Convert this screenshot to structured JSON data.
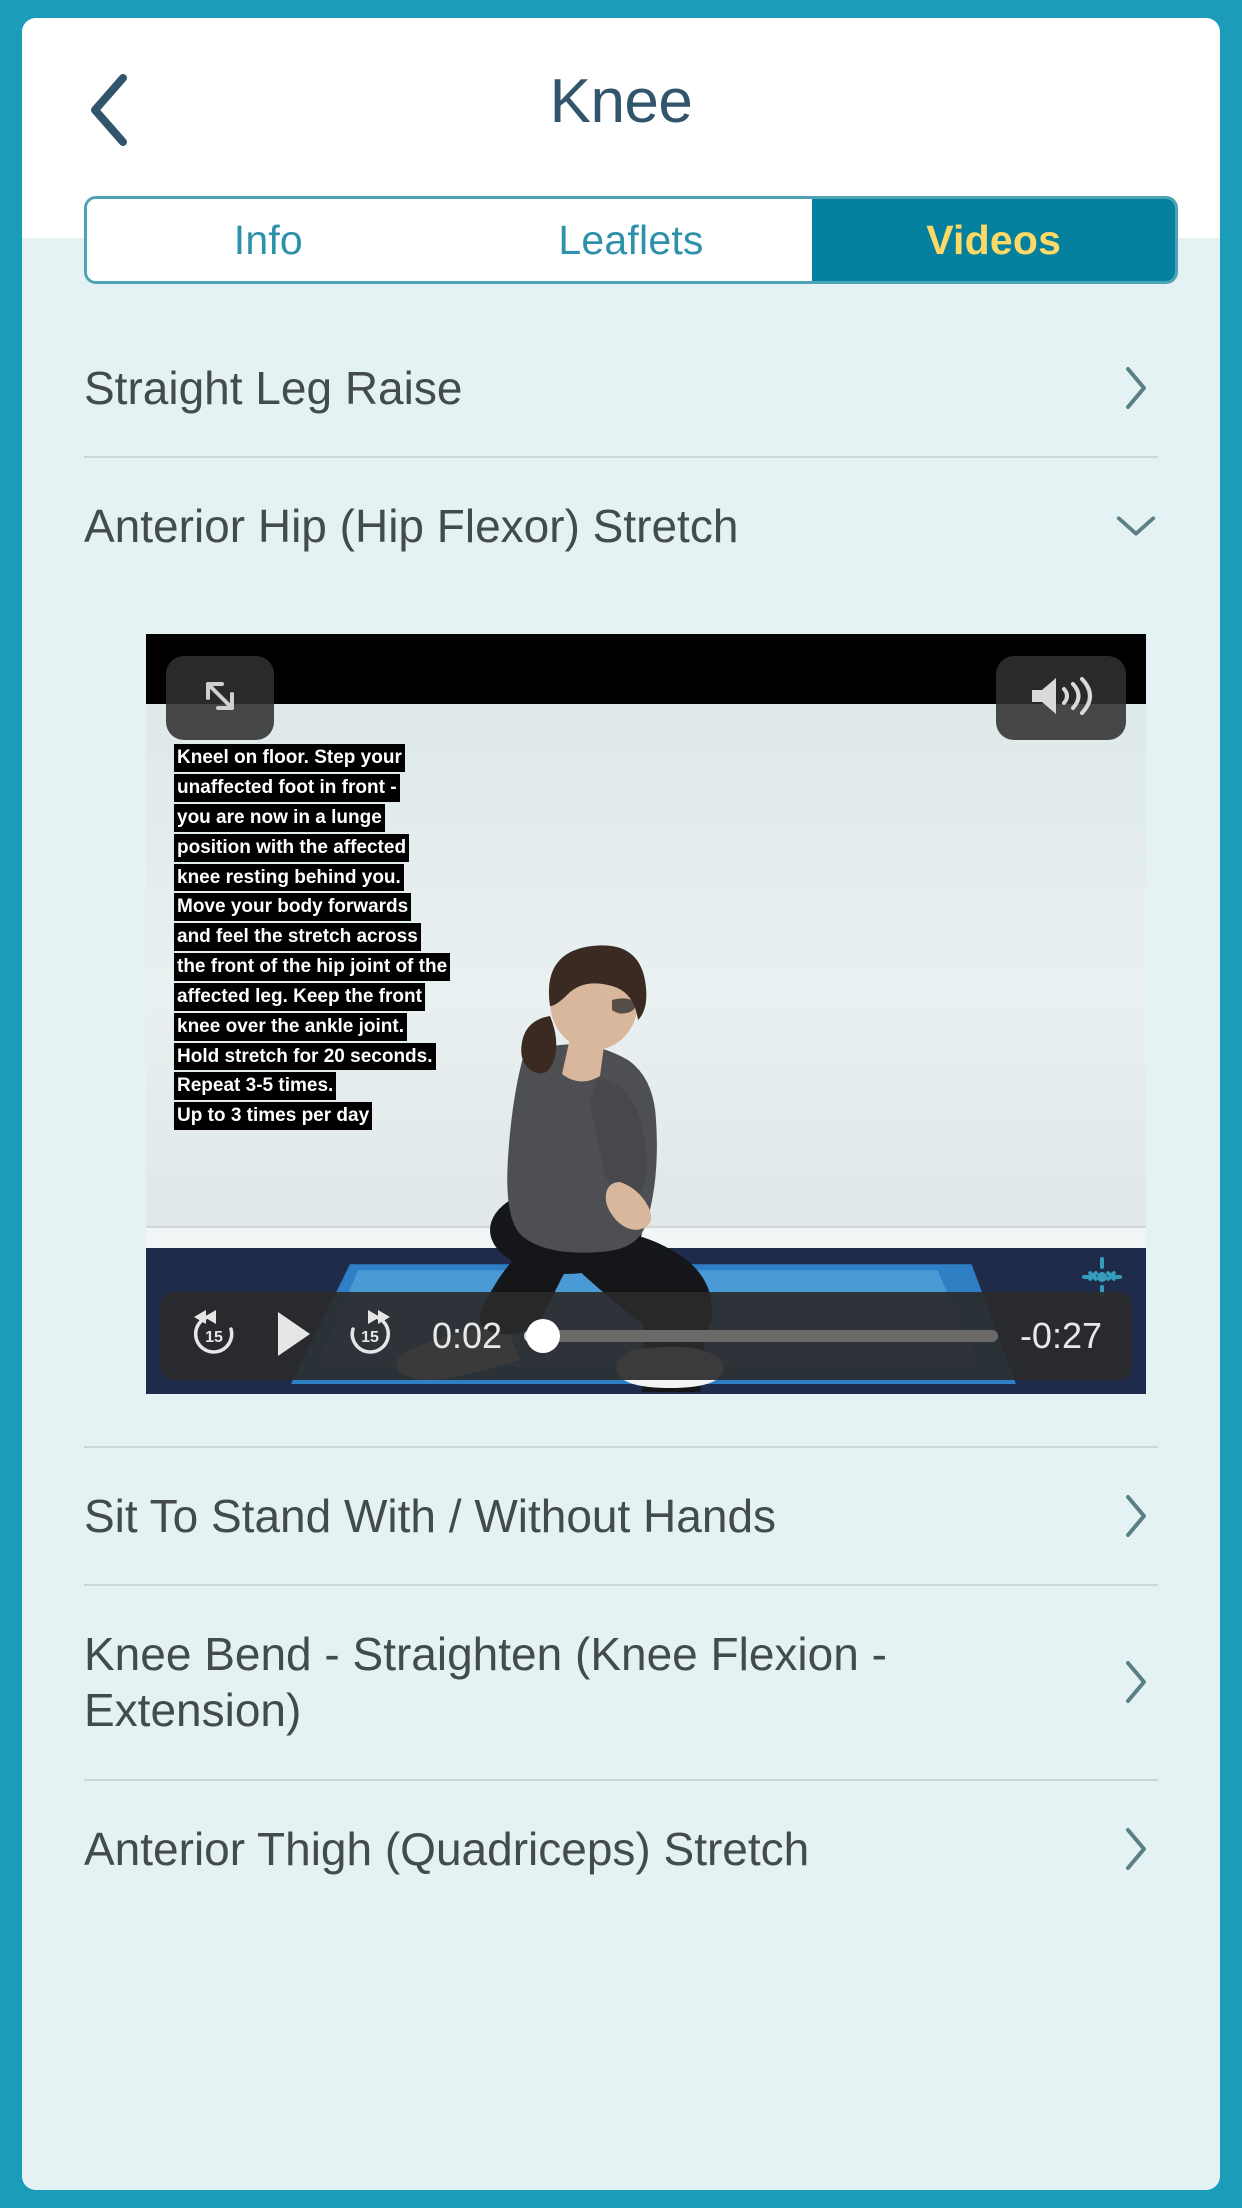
{
  "header": {
    "title": "Knee",
    "back_icon": "chevron-left-icon"
  },
  "tabs": [
    {
      "label": "Info",
      "active": false
    },
    {
      "label": "Leaflets",
      "active": false
    },
    {
      "label": "Videos",
      "active": true
    }
  ],
  "colors": {
    "app_frame": "#1b9cb8",
    "content_bg": "#e4f2f4",
    "tab_active_bg": "#05809e",
    "tab_active_text": "#ffd966",
    "tab_text": "#2e91aa",
    "title_text": "#31556b",
    "row_text": "#444b4d",
    "divider": "#c8d8da"
  },
  "list": [
    {
      "label": "Straight Leg Raise",
      "chevron": "chevron-right-icon",
      "expanded": false
    },
    {
      "label": "Anterior Hip (Hip Flexor) Stretch",
      "chevron": "chevron-down-icon",
      "expanded": true
    },
    {
      "label": "Sit To Stand With / Without Hands",
      "chevron": "chevron-right-icon",
      "expanded": false
    },
    {
      "label": "Knee Bend - Straighten (Knee Flexion - Extension)",
      "chevron": "chevron-right-icon",
      "expanded": false
    },
    {
      "label": "Anterior Thigh (Quadriceps) Stretch",
      "chevron": "chevron-right-icon",
      "expanded": false
    }
  ],
  "video": {
    "expand_icon": "fullscreen-expand-icon",
    "volume_icon": "volume-high-icon",
    "rewind_icon": "rewind-15-icon",
    "play_icon": "play-icon",
    "forward_icon": "forward-15-icon",
    "current_time": "0:02",
    "remaining_time": "-0:27",
    "progress_percent": 4,
    "caption_lines": [
      "Kneel on floor. Step your",
      "unaffected foot in front -",
      "you are now in a lunge",
      "position with the affected",
      "knee resting behind you.",
      "Move your body forwards",
      "and feel the stretch across",
      "the front of the hip joint of the",
      "affected leg. Keep the front",
      "knee over the ankle joint.",
      "Hold stretch for 20 seconds.",
      "Repeat 3-5 times.",
      "Up to 3 times per day"
    ]
  }
}
